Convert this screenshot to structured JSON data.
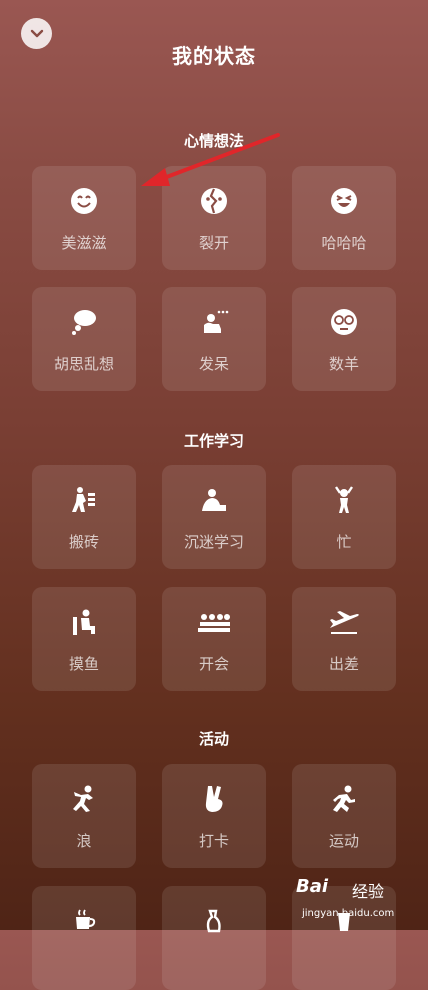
{
  "header": {
    "title": "我的状态",
    "close_icon": "chevron-down-icon"
  },
  "sections": [
    {
      "title": "心情想法",
      "items": [
        {
          "label": "美滋滋",
          "icon": "smile-icon"
        },
        {
          "label": "裂开",
          "icon": "broken-heart-icon"
        },
        {
          "label": "哈哈哈",
          "icon": "laughing-face-icon"
        },
        {
          "label": "胡思乱想",
          "icon": "thought-bubble-icon"
        },
        {
          "label": "发呆",
          "icon": "daydream-icon"
        },
        {
          "label": "数羊",
          "icon": "sleepy-face-icon"
        }
      ]
    },
    {
      "title": "工作学习",
      "items": [
        {
          "label": "搬砖",
          "icon": "carry-bricks-icon"
        },
        {
          "label": "沉迷学习",
          "icon": "studying-icon"
        },
        {
          "label": "忙",
          "icon": "busy-person-icon"
        },
        {
          "label": "摸鱼",
          "icon": "slacking-icon"
        },
        {
          "label": "开会",
          "icon": "meeting-icon"
        },
        {
          "label": "出差",
          "icon": "airplane-icon"
        }
      ]
    },
    {
      "title": "活动",
      "items": [
        {
          "label": "浪",
          "icon": "dancing-icon"
        },
        {
          "label": "打卡",
          "icon": "peace-hand-icon"
        },
        {
          "label": "运动",
          "icon": "running-icon"
        },
        {
          "label": "",
          "icon": "coffee-icon"
        },
        {
          "label": "",
          "icon": "drink-icon"
        },
        {
          "label": "",
          "icon": "cup-icon"
        }
      ]
    }
  ],
  "watermark": {
    "logo": "Bai",
    "text": "经验",
    "url": "jingyan.baidu.com"
  },
  "annotation": {
    "color": "#e0262a"
  }
}
